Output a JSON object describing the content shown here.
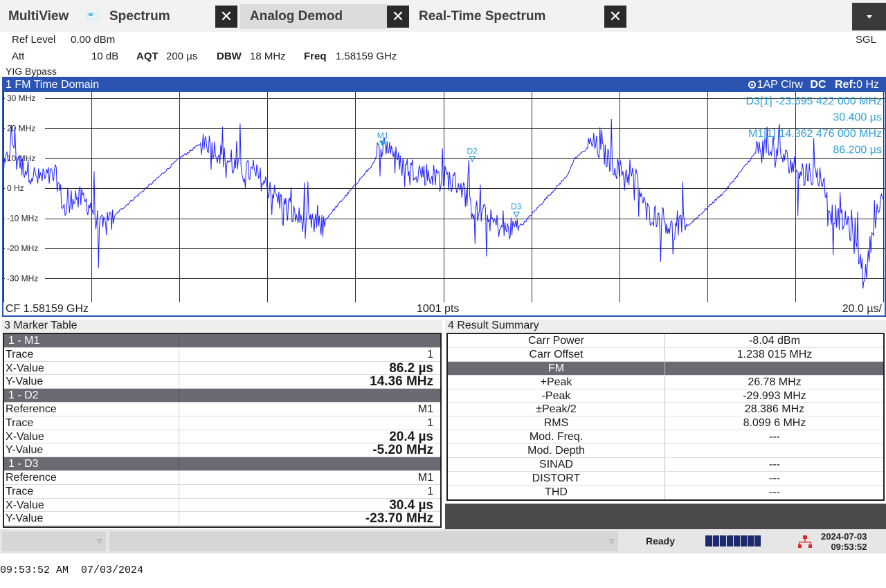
{
  "tabs": {
    "multiview": "MultiView",
    "spectrum": "Spectrum",
    "analog_demod": "Analog Demod",
    "realtime": "Real-Time Spectrum",
    "close": "✕"
  },
  "menu_icon": "chevron-down-icon",
  "settings": {
    "ref_level_label": "Ref Level",
    "ref_level_value": "0.00 dBm",
    "att_label": "Att",
    "att_value": "10 dB",
    "aqt_label": "AQT",
    "aqt_value": "200 µs",
    "dbw_label": "DBW",
    "dbw_value": "18 MHz",
    "freq_label": "Freq",
    "freq_value": "1.58159 GHz",
    "yig": "YIG Bypass",
    "sgl": "SGL"
  },
  "diagram": {
    "title": "1 FM Time Domain",
    "trace_mode": "1AP Clrw",
    "coupling": "DC",
    "ref": "Ref:",
    "ref_value": "0 Hz",
    "cf": "CF 1.58159 GHz",
    "pts": "1001 pts",
    "div": "20.0 µs/",
    "marker_readout": [
      {
        "name": "D3[1]",
        "value": "-23.695 422 000 MHz"
      },
      {
        "name": "",
        "value": "30.400 µs"
      },
      {
        "name": "M1[1]",
        "value": "14.362 476 000 MHz"
      },
      {
        "name": "",
        "value": "86.200 µs"
      }
    ],
    "marker_labels": {
      "m1": "M1",
      "d2": "D2",
      "d3": "D3"
    }
  },
  "chart_data": {
    "type": "line",
    "title": "1 FM Time Domain",
    "xlabel": "",
    "ylabel": "",
    "x_unit": "µs",
    "xlim": [
      0,
      200
    ],
    "ylim": [
      -35,
      35
    ],
    "yticks": [
      "30 MHz",
      "20 MHz",
      "10 MHz",
      "0 Hz",
      "-10 MHz",
      "-20 MHz",
      "-30 MHz"
    ],
    "ytick_values": [
      30,
      20,
      10,
      0,
      -10,
      -20,
      -30
    ],
    "grid": true,
    "series": [
      {
        "color": "#1f1fff",
        "points": [
          [
            0,
            5
          ],
          [
            2,
            16
          ],
          [
            4,
            8
          ],
          [
            8,
            3
          ],
          [
            12,
            4
          ],
          [
            14,
            -8
          ],
          [
            16,
            -2
          ],
          [
            20,
            -6
          ],
          [
            22,
            -13
          ],
          [
            24,
            -12
          ],
          [
            26,
            -8
          ],
          [
            34,
            2
          ],
          [
            40,
            10
          ],
          [
            46,
            16
          ],
          [
            48,
            13
          ],
          [
            52,
            8
          ],
          [
            58,
            4
          ],
          [
            62,
            -3
          ],
          [
            66,
            -9
          ],
          [
            70,
            -12
          ],
          [
            72,
            -13
          ],
          [
            74,
            -9
          ],
          [
            84,
            8
          ],
          [
            86,
            14
          ],
          [
            88,
            14
          ],
          [
            90,
            8
          ],
          [
            96,
            5
          ],
          [
            100,
            4
          ],
          [
            104,
            1
          ],
          [
            106,
            -6
          ],
          [
            110,
            -10
          ],
          [
            114,
            -14
          ],
          [
            116,
            -13
          ],
          [
            118,
            -12
          ],
          [
            128,
            4
          ],
          [
            130,
            10
          ],
          [
            134,
            15
          ],
          [
            136,
            12
          ],
          [
            140,
            6
          ],
          [
            144,
            3
          ],
          [
            146,
            -8
          ],
          [
            150,
            -10
          ],
          [
            152,
            -14
          ],
          [
            154,
            -13
          ],
          [
            156,
            -12
          ],
          [
            164,
            -1
          ],
          [
            170,
            10
          ],
          [
            172,
            14
          ],
          [
            176,
            12
          ],
          [
            180,
            7
          ],
          [
            186,
            4
          ],
          [
            188,
            -8
          ],
          [
            192,
            -12
          ],
          [
            196,
            -29
          ],
          [
            198,
            -10
          ],
          [
            200,
            -4
          ]
        ]
      }
    ],
    "markers": [
      {
        "name": "M1",
        "x": 86.2,
        "y": 14.36
      },
      {
        "name": "D2",
        "x": 106.6,
        "y": 9.16
      },
      {
        "name": "D3",
        "x": 116.6,
        "y": -9.34
      }
    ]
  },
  "marker_table": {
    "title": "3 Marker Table",
    "groups": [
      {
        "header": "1 - M1",
        "rows": [
          {
            "label": "Trace",
            "value": "1",
            "big": false
          },
          {
            "label": "X-Value",
            "value": "86.2 µs",
            "big": true
          },
          {
            "label": "Y-Value",
            "value": "14.36 MHz",
            "big": true
          }
        ]
      },
      {
        "header": "1 - D2",
        "rows": [
          {
            "label": "Reference",
            "value": "M1",
            "big": false
          },
          {
            "label": "Trace",
            "value": "1",
            "big": false
          },
          {
            "label": "X-Value",
            "value": "20.4 µs",
            "big": true
          },
          {
            "label": "Y-Value",
            "value": "-5.20 MHz",
            "big": true
          }
        ]
      },
      {
        "header": "1 - D3",
        "rows": [
          {
            "label": "Reference",
            "value": "M1",
            "big": false
          },
          {
            "label": "Trace",
            "value": "1",
            "big": false
          },
          {
            "label": "X-Value",
            "value": "30.4 µs",
            "big": true
          },
          {
            "label": "Y-Value",
            "value": "-23.70 MHz",
            "big": true
          }
        ]
      }
    ]
  },
  "result_summary": {
    "title": "4 Result Summary",
    "rows": [
      {
        "label": "Carr Power",
        "value": "-8.04 dBm",
        "head": false
      },
      {
        "label": "Carr Offset",
        "value": "1.238 015 MHz",
        "head": false
      },
      {
        "label": "FM",
        "value": "",
        "head": true
      },
      {
        "label": "+Peak",
        "value": "26.78 MHz",
        "head": false
      },
      {
        "label": "-Peak",
        "value": "-29.993 MHz",
        "head": false
      },
      {
        "label": "±Peak/2",
        "value": "28.386 MHz",
        "head": false
      },
      {
        "label": "RMS",
        "value": "8.099 6 MHz",
        "head": false
      },
      {
        "label": "Mod. Freq.",
        "value": "---",
        "head": false
      },
      {
        "label": "Mod. Depth",
        "value": "",
        "head": false
      },
      {
        "label": "SINAD",
        "value": "---",
        "head": false
      },
      {
        "label": "DISTORT",
        "value": "---",
        "head": false
      },
      {
        "label": "THD",
        "value": "---",
        "head": false
      }
    ]
  },
  "status": {
    "ready": "Ready",
    "date": "2024-07-03",
    "time": "09:53:52",
    "dropdown_arrow": "▽"
  },
  "clock": {
    "time": "09:53:52 AM",
    "date": "07/03/2024"
  }
}
